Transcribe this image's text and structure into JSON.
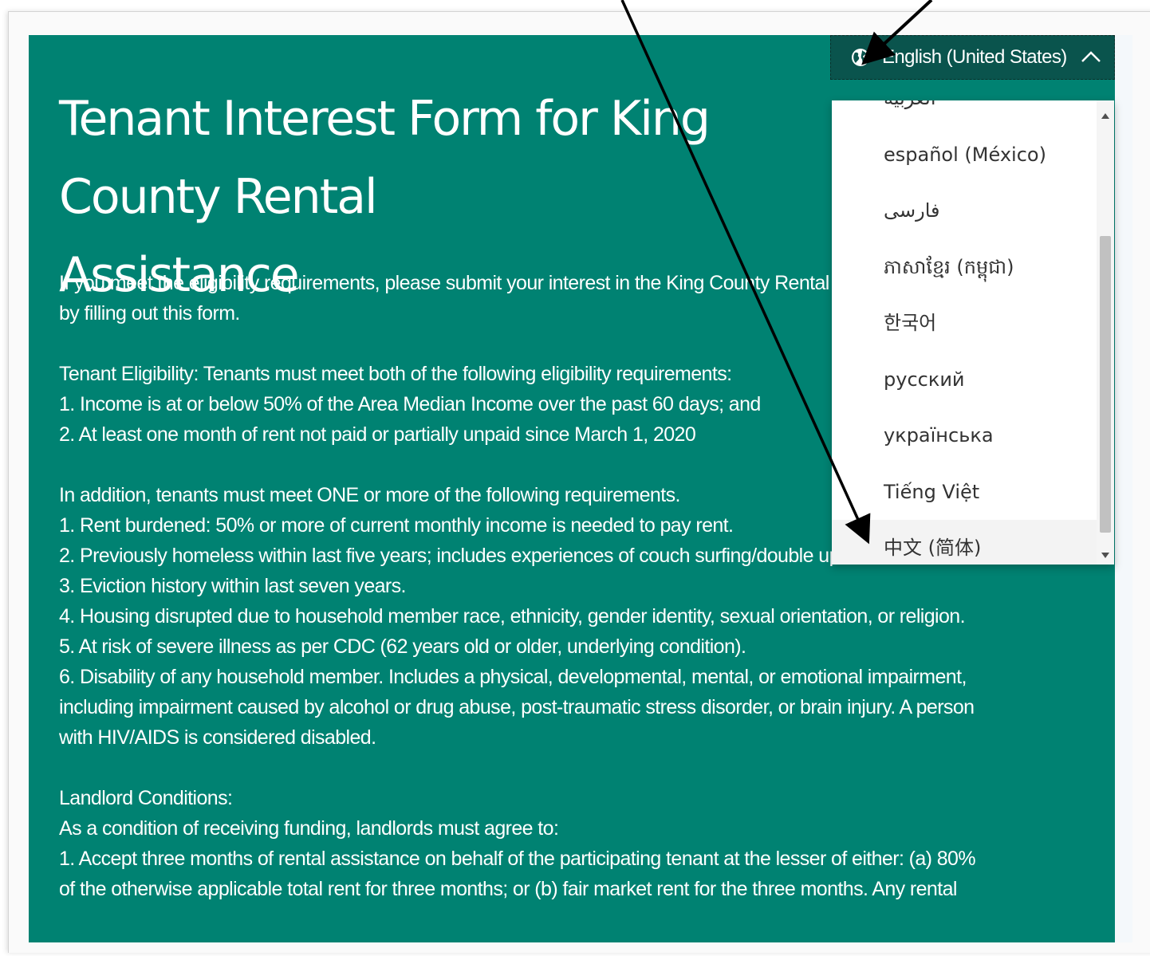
{
  "form": {
    "title": "Tenant Interest Form for King County Rental\nAssistance",
    "description": "If you meet the eligibility requirements, please submit your interest in the King County Rental Assistance program\nby filling out this form.\n\nTenant Eligibility:  Tenants must meet both of the following eligibility requirements:\n1. Income is at or below 50% of the Area Median Income over the past 60 days; and\n2. At least one month of rent not paid or partially unpaid since March 1, 2020\n\nIn addition, tenants must meet ONE or more of the following requirements.\n1. Rent burdened: 50% or more of current monthly income is needed to pay rent.\n2. Previously homeless within last five years; includes experiences of couch surfing/double up.\n3. Eviction history within last seven years.\n4. Housing disrupted due to household member race, ethnicity, gender identity, sexual orientation, or religion.\n5. At risk of severe illness as per CDC (62 years old or older, underlying condition).\n6. Disability of any household member. Includes a physical, developmental, mental, or emotional impairment,\nincluding impairment caused by alcohol or drug abuse, post-traumatic stress disorder, or brain injury. A person\nwith HIV/AIDS is considered disabled.\n\nLandlord Conditions:\nAs a condition of receiving funding, landlords must agree to:\n1.     Accept three months of rental assistance on behalf of the participating tenant at the lesser of either: (a) 80%\nof the otherwise applicable total rent for three months; or (b) fair market rent for the three months. Any rental"
  },
  "language_selector": {
    "selected": "English (United States)",
    "icon": "globe-icon",
    "expanded": true,
    "options": [
      "العربية",
      "español (México)",
      "فارسی",
      "ភាសាខ្មែរ (កម្ពុជា)",
      "한국어",
      "русский",
      "українська",
      "Tiếng Việt",
      "中文 (简体)"
    ]
  },
  "colors": {
    "background_teal": "#008272",
    "selector_dark": "#0a544d",
    "menu_bg": "#ffffff"
  }
}
